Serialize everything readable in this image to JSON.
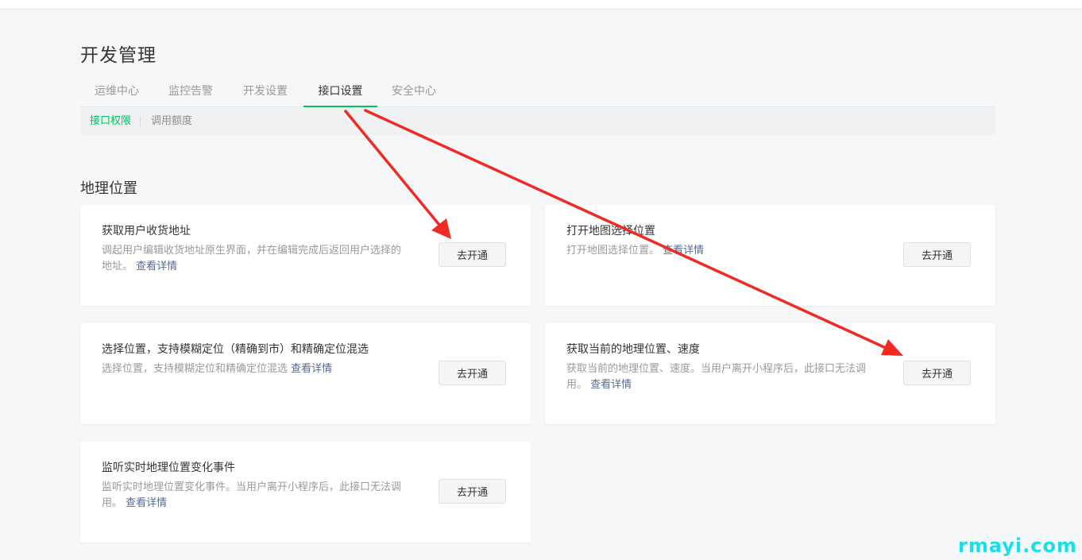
{
  "page_title": "开发管理",
  "tabs": [
    {
      "label": "运维中心"
    },
    {
      "label": "监控告警"
    },
    {
      "label": "开发设置"
    },
    {
      "label": "接口设置",
      "active": true
    },
    {
      "label": "安全中心"
    }
  ],
  "subnav": {
    "active": "接口权限",
    "other": "调用额度"
  },
  "section_title": "地理位置",
  "cards": [
    {
      "title": "获取用户收货地址",
      "desc": "调起用户编辑收货地址原生界面，并在编辑完成后返回用户选择的地址。",
      "link": "查看详情",
      "button": "去开通"
    },
    {
      "title": "打开地图选择位置",
      "desc": "打开地图选择位置。",
      "link": "查看详情",
      "button": "去开通"
    },
    {
      "title": "选择位置，支持模糊定位（精确到市）和精确定位混选",
      "desc": "选择位置，支持模糊定位和精确定位混选",
      "link": "查看详情",
      "button": "去开通"
    },
    {
      "title": "获取当前的地理位置、速度",
      "desc": "获取当前的地理位置、速度。当用户离开小程序后，此接口无法调用。",
      "link": "查看详情",
      "button": "去开通"
    },
    {
      "title": "监听实时地理位置变化事件",
      "desc": "监听实时地理位置变化事件。当用户离开小程序后，此接口无法调用。",
      "link": "查看详情",
      "button": "去开通"
    }
  ],
  "annotation_color": "#ee2b24",
  "watermark": "rmayi.com"
}
